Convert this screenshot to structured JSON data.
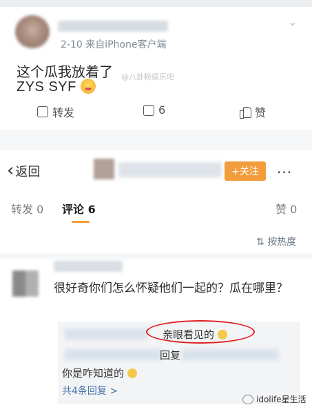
{
  "post": {
    "meta": "2-10  来自iPhone客户端",
    "text_line1": "这个瓜我放着了",
    "text_line2": "ZYS SYF",
    "watermark": "@八卦粉娱乐吧",
    "actions": {
      "forward": "转发",
      "comment_count": "6",
      "like": "赞"
    }
  },
  "header": {
    "back_label": "返回",
    "follow_label": "+关注",
    "more_label": "···"
  },
  "tabs": {
    "forward": "转发 0",
    "comment": "评论 6",
    "like": "赞 0",
    "accent": "#f39c3c"
  },
  "sort_label": "按热度",
  "comment": {
    "text": "很好奇你们怎么怀疑他们一起的？瓜在哪里？",
    "replies": {
      "line1": "亲眼看见的",
      "line2": "回复",
      "line3": "你是咋知道的",
      "more": "共4条回复 >"
    }
  },
  "brand": "idolife星生活",
  "icons": {
    "forward": "forward-icon",
    "comment": "comment-icon",
    "like": "thumbs-up-icon",
    "sort": "sort-icon",
    "chevron": "chevron-down-icon"
  }
}
